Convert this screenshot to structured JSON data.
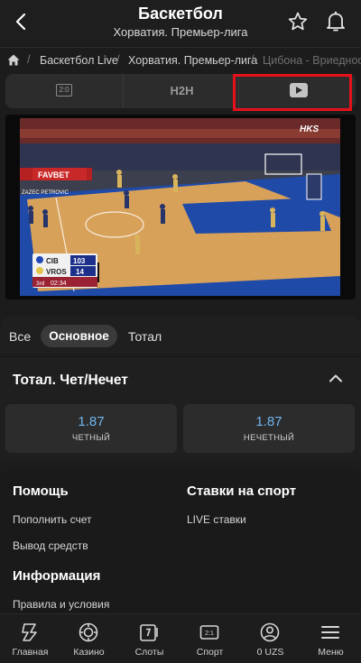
{
  "header": {
    "title": "Баскетбол",
    "subtitle": "Хорватия. Премьер-лига"
  },
  "breadcrumb": [
    "Баскетбол Live",
    "Хорватия. Премьер-лига",
    "Цибона - Вриедносни"
  ],
  "tabs": {
    "score_icon_text": "2:0",
    "h2h": "H2H",
    "video": "video-icon"
  },
  "video": {
    "scoreboard": {
      "team1": "CIB",
      "score1": "103",
      "team2": "VROS",
      "score2": "14",
      "period": "3rd",
      "clock": "02:34"
    },
    "ad_banner": "FAVBET",
    "watermark": "HKS",
    "court_text": "ZAZEC PETROVIC"
  },
  "market_filter": {
    "items": [
      "Все",
      "Основное",
      "Тотал"
    ],
    "active": "Основное"
  },
  "market": {
    "title": "Тотал. Чет/Нечет",
    "bets": [
      {
        "odd": "1.87",
        "label": "ЧЕТНЫЙ"
      },
      {
        "odd": "1.87",
        "label": "НЕЧЕТНЫЙ"
      }
    ]
  },
  "footer": {
    "help_title": "Помощь",
    "help_links": [
      "Пополнить счет",
      "Вывод средств"
    ],
    "sports_title": "Ставки на спорт",
    "sports_links": [
      "LIVE ставки"
    ],
    "info_title": "Информация",
    "info_links": [
      "Правила и условия"
    ]
  },
  "bottom_nav": [
    {
      "label": "Главная",
      "icon": "home-icon"
    },
    {
      "label": "Казино",
      "icon": "casino-chip-icon"
    },
    {
      "label": "Слоты",
      "icon": "slots-icon"
    },
    {
      "label": "Спорт",
      "icon": "sport-icon"
    },
    {
      "label": "0 UZS",
      "icon": "account-icon"
    },
    {
      "label": "Меню",
      "icon": "menu-icon"
    }
  ]
}
